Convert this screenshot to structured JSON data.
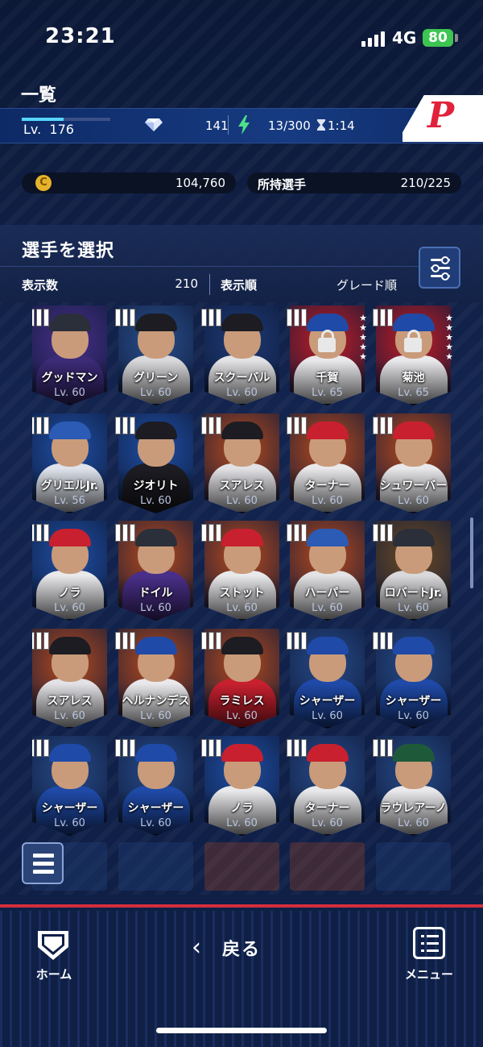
{
  "status_bar": {
    "time": "23:21",
    "network": "4G",
    "battery": "80"
  },
  "header": {
    "title": "一覧"
  },
  "level_bar": {
    "level_label": "Lv.",
    "level": "176",
    "level_progress": 0.47,
    "gems": "141",
    "stamina": "13/300",
    "stamina_timer": "1:14",
    "team_logo": "P"
  },
  "currency": {
    "coins": "104,760",
    "coin_symbol": "C",
    "owned_label": "所持選手",
    "owned_value": "210/225"
  },
  "select": {
    "title": "選手を選択",
    "count_label": "表示数",
    "count_value": "210",
    "order_label": "表示順",
    "order_value": "グレード順"
  },
  "cards": [
    {
      "name": "グッドマン",
      "lv": "Lv. 60",
      "bg": "#4a2f8a",
      "cap": "#2b2f3a",
      "body": "#3c2b78"
    },
    {
      "name": "グリーン",
      "lv": "Lv. 60",
      "bg": "#2a4f8c",
      "cap": "#1c1c22",
      "body": "#d9d9dc"
    },
    {
      "name": "スクーバル",
      "lv": "Lv. 60",
      "bg": "#1e3a75",
      "cap": "#1c1c22",
      "body": "#e3e3e6"
    },
    {
      "name": "千賀",
      "lv": "Lv. 65",
      "bg": "#c51c24",
      "cap": "#1f4aa8",
      "body": "#e9e9ec",
      "locked": true,
      "stars": "★★★★★"
    },
    {
      "name": "菊池",
      "lv": "Lv. 65",
      "bg": "#c51c24",
      "cap": "#1f4aa8",
      "body": "#e9e9ec",
      "locked": true,
      "stars": "★★★★★"
    },
    {
      "name": "グリエルJr.",
      "lv": "Lv. 56",
      "bg": "#1f4fa6",
      "cap": "#2b5bb5",
      "body": "#dfe3ec"
    },
    {
      "name": "ジオリト",
      "lv": "Lv. 60",
      "bg": "#1f4fa6",
      "cap": "#1c1c22",
      "body": "#1c1c22"
    },
    {
      "name": "スアレス",
      "lv": "Lv. 60",
      "bg": "#b84a1c",
      "cap": "#1c1c22",
      "body": "#e2e2e6"
    },
    {
      "name": "ターナー",
      "lv": "Lv. 60",
      "bg": "#b84a1c",
      "cap": "#c8202f",
      "body": "#e9e9ec"
    },
    {
      "name": "シュワーバー",
      "lv": "Lv. 60",
      "bg": "#b84a1c",
      "cap": "#c8202f",
      "body": "#e9e9ec"
    },
    {
      "name": "ノラ",
      "lv": "Lv. 60",
      "bg": "#1f4fa6",
      "cap": "#c8202f",
      "body": "#e9e9ec"
    },
    {
      "name": "ドイル",
      "lv": "Lv. 60",
      "bg": "#b84a1c",
      "cap": "#2b2f3a",
      "body": "#4a2f8a"
    },
    {
      "name": "ストット",
      "lv": "Lv. 60",
      "bg": "#b84a1c",
      "cap": "#c8202f",
      "body": "#e9e9ec"
    },
    {
      "name": "ハーパー",
      "lv": "Lv. 60",
      "bg": "#b84a1c",
      "cap": "#2b5bb5",
      "body": "#e3e3e6"
    },
    {
      "name": "ロバートJr.",
      "lv": "Lv. 60",
      "bg": "#6e4a22",
      "cap": "#2b2f3a",
      "body": "#d9d9dc"
    },
    {
      "name": "スアレス",
      "lv": "Lv. 60",
      "bg": "#b84a1c",
      "cap": "#1c1c22",
      "body": "#e2e2e6"
    },
    {
      "name": "ヘルナンデス",
      "lv": "Lv. 60",
      "bg": "#b84a1c",
      "cap": "#1f4aa8",
      "body": "#e9e9ec"
    },
    {
      "name": "ラミレス",
      "lv": "Lv. 60",
      "bg": "#b84a1c",
      "cap": "#1c1c22",
      "body": "#c8202f"
    },
    {
      "name": "シャーザー",
      "lv": "Lv. 60",
      "bg": "#274a88",
      "cap": "#1f4aa8",
      "body": "#1f4aa8"
    },
    {
      "name": "シャーザー",
      "lv": "Lv. 60",
      "bg": "#274a88",
      "cap": "#1f4aa8",
      "body": "#1f4aa8"
    },
    {
      "name": "シャーザー",
      "lv": "Lv. 60",
      "bg": "#274a88",
      "cap": "#1f4aa8",
      "body": "#1f4aa8"
    },
    {
      "name": "シャーザー",
      "lv": "Lv. 60",
      "bg": "#274a88",
      "cap": "#1f4aa8",
      "body": "#1f4aa8"
    },
    {
      "name": "ノラ",
      "lv": "Lv. 60",
      "bg": "#1f4fa6",
      "cap": "#c8202f",
      "body": "#e9e9ec"
    },
    {
      "name": "ターナー",
      "lv": "Lv. 60",
      "bg": "#274a88",
      "cap": "#c8202f",
      "body": "#e9e9ec"
    },
    {
      "name": "ラウレアーノ",
      "lv": "Lv. 60",
      "bg": "#274a88",
      "cap": "#1e5a3a",
      "body": "#e9e9ec"
    }
  ],
  "nav": {
    "home_label": "ホーム",
    "back_label": "戻る",
    "menu_label": "メニュー"
  }
}
